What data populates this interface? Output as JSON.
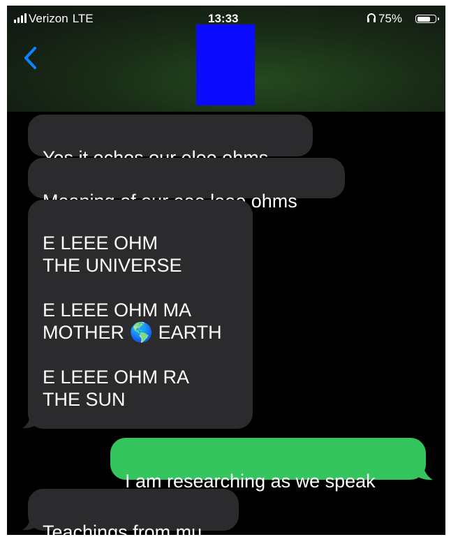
{
  "status_bar": {
    "carrier": "Verizon",
    "network": "LTE",
    "time": "13:33",
    "battery": "75%",
    "battery_level": 0.75
  },
  "header": {
    "back_icon": "chevron-left-icon",
    "contact_avatar": "redacted-block",
    "accent_color": "#0a84ff",
    "redaction_color": "#0a0afe"
  },
  "messages": [
    {
      "direction": "incoming",
      "text": "Yes it echos our elee ohms"
    },
    {
      "direction": "incoming",
      "text": "Meaning of our eee leee ohms"
    },
    {
      "direction": "incoming",
      "text": "E LEEE OHM\nTHE UNIVERSE\n\nE LEEE OHM MA\nMOTHER 🌎 EARTH\n\nE LEEE OHM RA\nTHE SUN"
    },
    {
      "direction": "outgoing",
      "text": "I am researching as we speak"
    },
    {
      "direction": "incoming",
      "text": "Teachings from mu"
    }
  ],
  "colors": {
    "incoming_bubble": "#2b2b2d",
    "outgoing_bubble": "#35c55e",
    "background": "#000000"
  }
}
